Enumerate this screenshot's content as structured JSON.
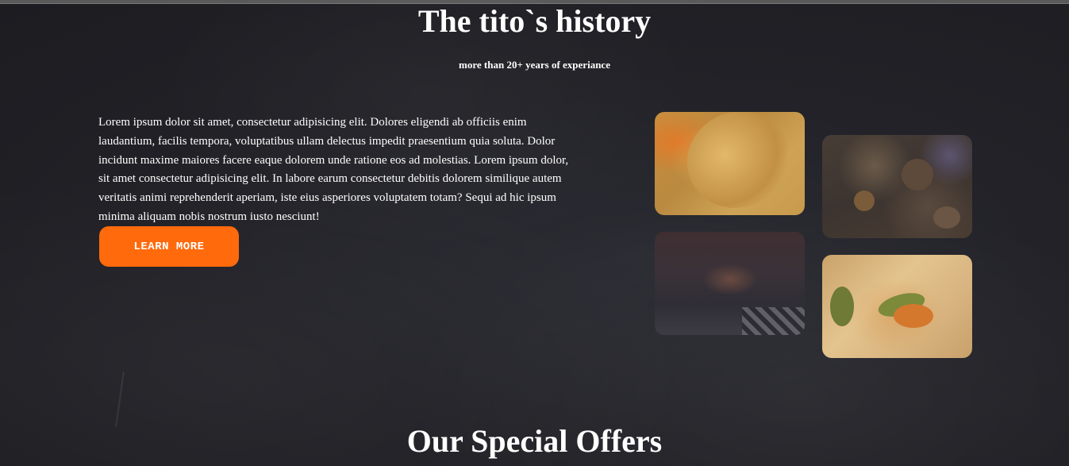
{
  "history": {
    "title": "The tito`s history",
    "subtitle": "more than 20+ years of experiance",
    "text": "Lorem ipsum dolor sit amet, consectetur adipisicing elit. Dolores eligendi ab officiis enim laudantium, facilis tempora, voluptatibus ullam delectus impedit praesentium quia soluta. Dolor incidunt maxime maiores facere eaque dolorem unde ratione eos ad molestias. Lorem ipsum dolor, sit amet consectetur adipisicing elit. In labore earum consectetur debitis dolorem similique autem veritatis animi reprehenderit aperiam, iste eius asperiores voluptatem totam? Sequi ad hic ipsum minima aliquam nobis nostrum iusto nesciunt!",
    "button_label": "LEARN MORE"
  },
  "offers": {
    "title": "Our Special Offers"
  },
  "colors": {
    "accent": "#ff6a0c",
    "background": "#222228"
  }
}
